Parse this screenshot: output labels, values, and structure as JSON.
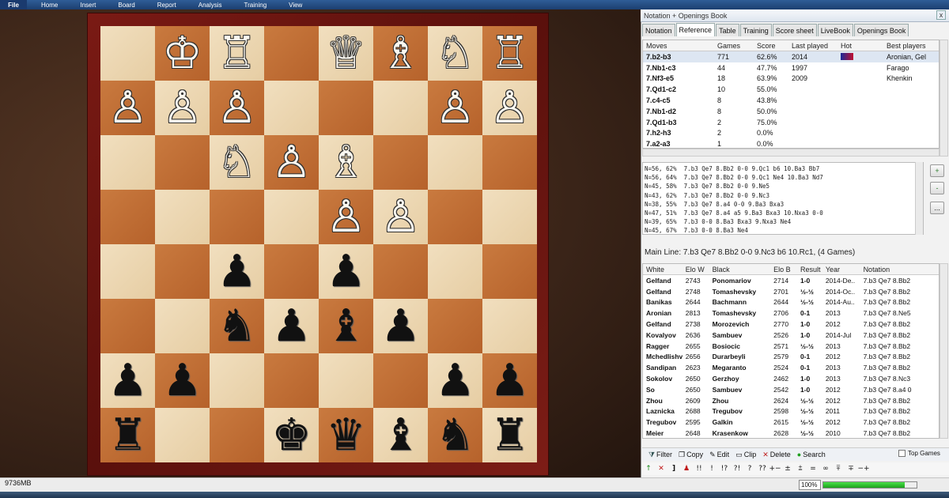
{
  "menu": {
    "file": "File",
    "items": [
      "Home",
      "Insert",
      "Board",
      "Report",
      "Analysis",
      "Training",
      "View"
    ]
  },
  "panel": {
    "title": "Notation + Openings Book",
    "close": "x"
  },
  "tabs": [
    "Notation",
    "Reference",
    "Table",
    "Training",
    "Score sheet",
    "LiveBook",
    "Openings Book"
  ],
  "active_tab": "Reference",
  "board": {
    "pieces": [
      [
        "",
        "♔",
        "♖",
        "",
        "♕",
        "♗",
        "♘",
        "♖"
      ],
      [
        "♙",
        "♙",
        "♙",
        "",
        "",
        "",
        "♙",
        "♙"
      ],
      [
        "",
        "",
        "♘",
        "♙",
        "♗",
        "",
        "",
        ""
      ],
      [
        "",
        "",
        "",
        "",
        "♙",
        "♙",
        "",
        ""
      ],
      [
        "",
        "",
        "♟",
        "",
        "♟",
        "",
        "",
        ""
      ],
      [
        "",
        "",
        "♞",
        "♟",
        "♝",
        "♟",
        "",
        ""
      ],
      [
        "♟",
        "♟",
        "",
        "",
        "",
        "",
        "♟",
        "♟"
      ],
      [
        "♜",
        "",
        "",
        "♚",
        "♛",
        "♝",
        "♞",
        "♜"
      ]
    ],
    "colors": [
      [
        "",
        "w",
        "w",
        "",
        "w",
        "w",
        "w",
        "w"
      ],
      [
        "w",
        "w",
        "w",
        "",
        "",
        "",
        "w",
        "w"
      ],
      [
        "",
        "",
        "w",
        "w",
        "w",
        "",
        "",
        ""
      ],
      [
        "",
        "",
        "",
        "",
        "w",
        "w",
        "",
        ""
      ],
      [
        "",
        "",
        "b",
        "",
        "b",
        "",
        "",
        ""
      ],
      [
        "",
        "",
        "b",
        "b",
        "b",
        "b",
        "",
        ""
      ],
      [
        "b",
        "b",
        "",
        "",
        "",
        "",
        "b",
        "b"
      ],
      [
        "b",
        "",
        "",
        "b",
        "b",
        "b",
        "b",
        "b"
      ]
    ]
  },
  "reference": {
    "headers": [
      "Moves",
      "Games",
      "Score",
      "Last played",
      "Hot",
      "Best players"
    ],
    "rows": [
      [
        "7.b2-b3",
        "771",
        "62.6%",
        "2014",
        "",
        "Aronian, Gel"
      ],
      [
        "7.Nb1-c3",
        "44",
        "47.7%",
        "1997",
        "",
        "Farago"
      ],
      [
        "7.Nf3-e5",
        "18",
        "63.9%",
        "2009",
        "",
        "Khenkin"
      ],
      [
        "7.Qd1-c2",
        "10",
        "55.0%",
        "",
        "",
        ""
      ],
      [
        "7.c4-c5",
        "8",
        "43.8%",
        "",
        "",
        ""
      ],
      [
        "7.Nb1-d2",
        "8",
        "50.0%",
        "",
        "",
        ""
      ],
      [
        "7.Qd1-b3",
        "2",
        "75.0%",
        "",
        "",
        ""
      ],
      [
        "7.h2-h3",
        "2",
        "0.0%",
        "",
        "",
        ""
      ],
      [
        "7.a2-a3",
        "1",
        "0.0%",
        "",
        "",
        ""
      ]
    ]
  },
  "tree": [
    "N=56, 62%  7.b3 Qe7 8.Bb2 0-0 9.Qc1 b6 10.Ba3 Bb7",
    "N=56, 64%  7.b3 Qe7 8.Bb2 0-0 9.Qc1 Ne4 10.Ba3 Nd7",
    "N=45, 58%  7.b3 Qe7 8.Bb2 0-0 9.Ne5",
    "N=43, 62%  7.b3 Qe7 8.Bb2 0-0 9.Nc3",
    "N=38, 55%  7.b3 Qe7 8.a4 0-0 9.Ba3 Bxa3",
    "N=47, 51%  7.b3 Qe7 8.a4 a5 9.Ba3 Bxa3 10.Nxa3 0-0",
    "N=39, 65%  7.b3 0-0 8.Ba3 Bxa3 9.Nxa3 Ne4",
    "N=45, 67%  7.b3 0-0 8.Ba3 Ne4"
  ],
  "zoom_buttons": [
    "+",
    "-",
    "..."
  ],
  "mainline": "Main Line: 7.b3 Qe7 8.Bb2 0-0 9.Nc3 b6 10.Rc1,  (4 Games)",
  "games": {
    "headers": [
      "White",
      "Elo W",
      "Black",
      "Elo B",
      "Result",
      "Year",
      "Notation"
    ],
    "rows": [
      [
        "Gelfand",
        "2743",
        "Ponomariov",
        "2714",
        "1-0",
        "2014-De..",
        "7.b3 Qe7 8.Bb2"
      ],
      [
        "Gelfand",
        "2748",
        "Tomashevsky",
        "2701",
        "½-½",
        "2014-Oc..",
        "7.b3 Qe7 8.Bb2"
      ],
      [
        "Banikas",
        "2644",
        "Bachmann",
        "2644",
        "½-½",
        "2014-Au..",
        "7.b3 Qe7 8.Bb2"
      ],
      [
        "Aronian",
        "2813",
        "Tomashevsky",
        "2706",
        "0-1",
        "2013",
        "7.b3 Qe7 8.Ne5"
      ],
      [
        "Gelfand",
        "2738",
        "Morozevich",
        "2770",
        "1-0",
        "2012",
        "7.b3 Qe7 8.Bb2"
      ],
      [
        "Kovalyov",
        "2636",
        "Sambuev",
        "2526",
        "1-0",
        "2014-Jul",
        "7.b3 Qe7 8.Bb2"
      ],
      [
        "Ragger",
        "2655",
        "Bosiocic",
        "2571",
        "½-½",
        "2013",
        "7.b3 Qe7 8.Bb2"
      ],
      [
        "Mchedlishvili",
        "2656",
        "Durarbeyli",
        "2579",
        "0-1",
        "2012",
        "7.b3 Qe7 8.Bb2"
      ],
      [
        "Sandipan",
        "2623",
        "Megaranto",
        "2524",
        "0-1",
        "2013",
        "7.b3 Qe7 8.Bb2"
      ],
      [
        "Sokolov",
        "2650",
        "Gerzhoy",
        "2462",
        "1-0",
        "2013",
        "7.b3 Qe7 8.Nc3"
      ],
      [
        "So",
        "2650",
        "Sambuev",
        "2542",
        "1-0",
        "2012",
        "7.b3 Qe7 8.a4 0"
      ],
      [
        "Zhou",
        "2609",
        "Zhou",
        "2624",
        "½-½",
        "2012",
        "7.b3 Qe7 8.Bb2"
      ],
      [
        "Laznicka",
        "2688",
        "Tregubov",
        "2598",
        "½-½",
        "2011",
        "7.b3 Qe7 8.Bb2"
      ],
      [
        "Tregubov",
        "2595",
        "Galkin",
        "2615",
        "½-½",
        "2012",
        "7.b3 Qe7 8.Bb2"
      ],
      [
        "Meier",
        "2648",
        "Krasenkow",
        "2628",
        "½-½",
        "2010",
        "7.b3 Qe7 8.Bb2"
      ]
    ]
  },
  "toolbar": [
    {
      "icon": "filter-icon",
      "glyph": "⧩",
      "label": "Filter"
    },
    {
      "icon": "copy-icon",
      "glyph": "❐",
      "label": "Copy"
    },
    {
      "icon": "edit-icon",
      "glyph": "✎",
      "label": "Edit"
    },
    {
      "icon": "clip-icon",
      "glyph": "▭",
      "label": "Clip"
    },
    {
      "icon": "delete-icon",
      "glyph": "✕",
      "label": "Delete"
    },
    {
      "icon": "search-icon",
      "glyph": "●",
      "label": "Search"
    }
  ],
  "top_games_label": "Top Games",
  "annotation_symbols": [
    "↑",
    "✕",
    "]",
    "♟",
    "!!",
    "!",
    "!?",
    "?!",
    "?",
    "??",
    "+−",
    "±",
    "⩲",
    "=",
    "∞",
    "⩱",
    "∓",
    "−+"
  ],
  "status": {
    "memory": "9736MB",
    "zoom": "100%",
    "progress_fraction": 0.87
  },
  "colors": {
    "accent": "#1c3f70",
    "board_light": "#f1dfbf",
    "board_dark": "#c97a3f",
    "frame": "#6a140f"
  }
}
